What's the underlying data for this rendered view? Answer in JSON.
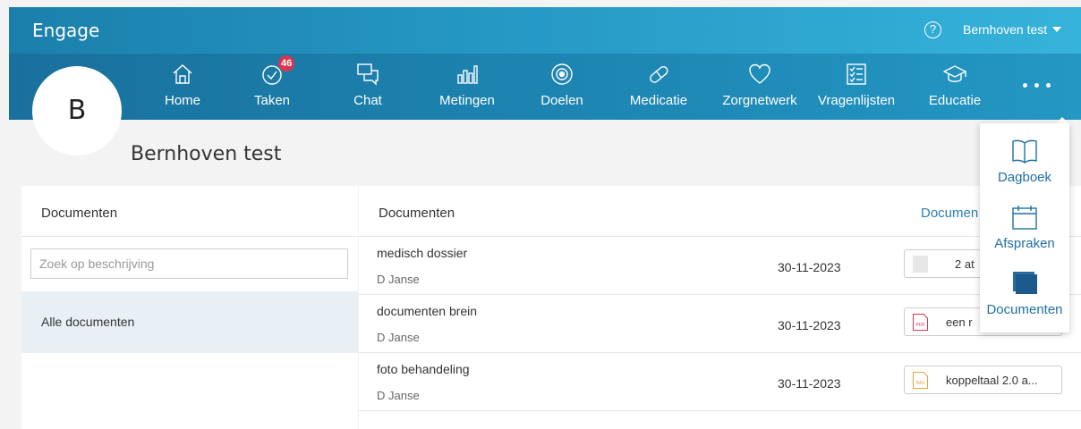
{
  "app": {
    "brand": "Engage"
  },
  "header": {
    "help_glyph": "?",
    "user_name": "Bernhoven test"
  },
  "nav": {
    "items": [
      {
        "label": "Home",
        "icon": "home-icon"
      },
      {
        "label": "Taken",
        "icon": "check-circle-icon",
        "badge": "46"
      },
      {
        "label": "Chat",
        "icon": "chat-icon"
      },
      {
        "label": "Metingen",
        "icon": "bar-chart-icon"
      },
      {
        "label": "Doelen",
        "icon": "target-icon"
      },
      {
        "label": "Medicatie",
        "icon": "pill-icon"
      },
      {
        "label": "Zorgnetwerk",
        "icon": "heart-icon"
      },
      {
        "label": "Vragenlijsten",
        "icon": "checklist-icon"
      },
      {
        "label": "Educatie",
        "icon": "graduation-cap-icon"
      }
    ],
    "more_icon": "more-dots-icon"
  },
  "profile": {
    "initial": "B",
    "name": "Bernhoven test"
  },
  "left_panel": {
    "title": "Documenten",
    "search_placeholder": "Zoek op beschrijving",
    "filters": [
      {
        "label": "Alle documenten"
      }
    ]
  },
  "right_panel": {
    "title": "Documenten",
    "column_link": "Documen",
    "rows": [
      {
        "title": "medisch dossier",
        "author": "D Janse",
        "date": "30-11-2023",
        "attachment": "2 at",
        "attachment_icon": "generic-file-icon"
      },
      {
        "title": "documenten brein",
        "author": "D Janse",
        "date": "30-11-2023",
        "attachment": "een r",
        "attachment_icon": "pdf-file-icon",
        "icon_text": "PDF"
      },
      {
        "title": "foto behandeling",
        "author": "D Janse",
        "date": "30-11-2023",
        "attachment": "koppeltaal 2.0 a...",
        "attachment_icon": "image-file-icon",
        "icon_text": "IMG"
      }
    ]
  },
  "more_menu": {
    "items": [
      {
        "label": "Dagboek",
        "icon": "book-icon"
      },
      {
        "label": "Afspraken",
        "icon": "calendar-icon"
      },
      {
        "label": "Documenten",
        "icon": "documents-icon"
      }
    ]
  },
  "colors": {
    "topbar": "#2598c4",
    "navbar": "#1d84b1",
    "badge": "#d9364f",
    "link": "#2a7fb2",
    "selected_filter": "#e8f0f5"
  }
}
